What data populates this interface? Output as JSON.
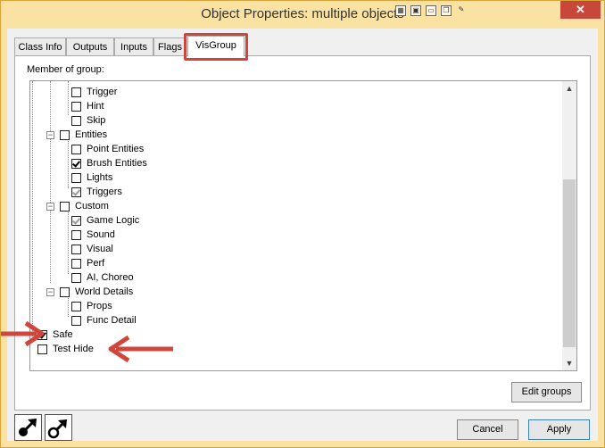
{
  "window": {
    "title": "Object Properties: multiple objects",
    "close_label": "✕",
    "toolbar_icons": [
      "grid-icon",
      "snap-icon",
      "window-icon",
      "copy-icon",
      "pin-icon"
    ]
  },
  "tabs": [
    {
      "label": "Class Info",
      "active": false
    },
    {
      "label": "Outputs",
      "active": false
    },
    {
      "label": "Inputs",
      "active": false
    },
    {
      "label": "Flags",
      "active": false
    },
    {
      "label": "VisGroup",
      "active": true
    }
  ],
  "panel": {
    "member_label": "Member of group:",
    "tree": [
      {
        "label": "Trigger",
        "level": 2,
        "state": "unchecked"
      },
      {
        "label": "Hint",
        "level": 2,
        "state": "unchecked"
      },
      {
        "label": "Skip",
        "level": 2,
        "state": "unchecked"
      },
      {
        "label": "Entities",
        "level": 1,
        "state": "unchecked",
        "expander": "−"
      },
      {
        "label": "Point Entities",
        "level": 2,
        "state": "unchecked"
      },
      {
        "label": "Brush Entities",
        "level": 2,
        "state": "checked"
      },
      {
        "label": "Lights",
        "level": 2,
        "state": "unchecked"
      },
      {
        "label": "Triggers",
        "level": 2,
        "state": "gray"
      },
      {
        "label": "Custom",
        "level": 1,
        "state": "unchecked",
        "expander": "−"
      },
      {
        "label": "Game Logic",
        "level": 2,
        "state": "gray"
      },
      {
        "label": "Sound",
        "level": 2,
        "state": "unchecked"
      },
      {
        "label": "Visual",
        "level": 2,
        "state": "unchecked"
      },
      {
        "label": "Perf",
        "level": 2,
        "state": "unchecked"
      },
      {
        "label": "AI, Choreo",
        "level": 2,
        "state": "unchecked"
      },
      {
        "label": "World Details",
        "level": 1,
        "state": "unchecked",
        "expander": "−"
      },
      {
        "label": "Props",
        "level": 2,
        "state": "unchecked"
      },
      {
        "label": "Func Detail",
        "level": 2,
        "state": "unchecked"
      },
      {
        "label": "Safe",
        "level": 0,
        "state": "checked"
      },
      {
        "label": "Test Hide",
        "level": 0,
        "state": "unchecked"
      }
    ],
    "edit_groups_label": "Edit groups"
  },
  "footer": {
    "cancel_label": "Cancel",
    "apply_label": "Apply",
    "tool_icons": [
      "pick-entity-icon",
      "pick-target-icon"
    ]
  },
  "colors": {
    "frame": "#fae2a2",
    "highlight": "#d0463c",
    "arrow": "#d0463c"
  }
}
